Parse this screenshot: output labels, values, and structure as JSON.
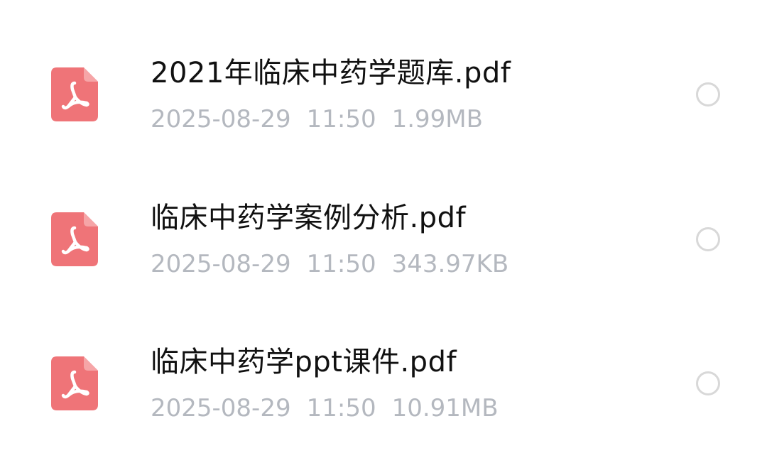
{
  "files": [
    {
      "name": "2021年临床中药学题库.pdf",
      "date": "2025-08-29",
      "time": "11:50",
      "size": "1.99MB",
      "icon": "pdf-file-icon",
      "selected": false
    },
    {
      "name": "临床中药学案例分析.pdf",
      "date": "2025-08-29",
      "time": "11:50",
      "size": "343.97KB",
      "icon": "pdf-file-icon",
      "selected": false
    },
    {
      "name": "临床中药学ppt课件.pdf",
      "date": "2025-08-29",
      "time": "11:50",
      "size": "10.91MB",
      "icon": "pdf-file-icon",
      "selected": false
    }
  ],
  "colors": {
    "pdf_icon": "#ee6f72",
    "file_name": "#111111",
    "meta_text": "#b4b8bf",
    "radio_border": "#d8d8d8",
    "background": "#ffffff"
  }
}
